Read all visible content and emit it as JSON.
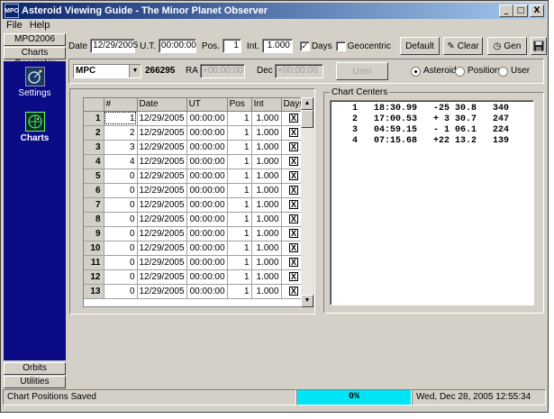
{
  "window": {
    "title": "Asteroid Viewing Guide - The Minor Planet Observer",
    "app_icon": "MPO",
    "controls": {
      "minimize": "_",
      "maximize": "□",
      "close": "X"
    }
  },
  "menu": {
    "file": "File",
    "help": "Help"
  },
  "nav": {
    "mpo_button": "MPO2006",
    "charts_generator": "Charts Generator",
    "settings_label": "Settings",
    "charts_label": "Charts",
    "orbits": "Orbits",
    "utilities": "Utilities"
  },
  "toolbar": {
    "date_label": "Date",
    "date_value": "12/29/2005",
    "ut_label": "U.T.",
    "ut_value": "00:00:00",
    "pos_label": "Pos.",
    "pos_value": "1",
    "int_label": "Int.",
    "int_value": "1.000",
    "days_label": "Days",
    "days_checked": true,
    "geocentric_label": "Geocentric",
    "geocentric_checked": false,
    "default_button": "Default",
    "clear_button": "Clear",
    "gen_button": "Gen"
  },
  "object_row": {
    "catalog_value": "MPC",
    "object_number": "266295",
    "ra_label": "RA",
    "ra_placeholder": "+00:00:00",
    "dec_label": "Dec",
    "dec_placeholder": "+00:00:00",
    "user_button": "User",
    "radio_asteroid": "Asteroid",
    "radio_position": "Position",
    "radio_user": "User",
    "selected": "Asteroid"
  },
  "grid": {
    "headers": [
      "#",
      "Date",
      "UT",
      "Pos",
      "Int",
      "Days"
    ],
    "rows": [
      {
        "row": "1",
        "num": "1",
        "date": "12/29/2005",
        "ut": "00:00:00",
        "pos": "1",
        "int": "1.000",
        "days": "X"
      },
      {
        "row": "2",
        "num": "2",
        "date": "12/29/2005",
        "ut": "00:00:00",
        "pos": "1",
        "int": "1.000",
        "days": "X"
      },
      {
        "row": "3",
        "num": "3",
        "date": "12/29/2005",
        "ut": "00:00:00",
        "pos": "1",
        "int": "1.000",
        "days": "X"
      },
      {
        "row": "4",
        "num": "4",
        "date": "12/29/2005",
        "ut": "00:00:00",
        "pos": "1",
        "int": "1.000",
        "days": "X"
      },
      {
        "row": "5",
        "num": "0",
        "date": "12/29/2005",
        "ut": "00:00:00",
        "pos": "1",
        "int": "1.000",
        "days": "X"
      },
      {
        "row": "6",
        "num": "0",
        "date": "12/29/2005",
        "ut": "00:00:00",
        "pos": "1",
        "int": "1.000",
        "days": "X"
      },
      {
        "row": "7",
        "num": "0",
        "date": "12/29/2005",
        "ut": "00:00:00",
        "pos": "1",
        "int": "1.000",
        "days": "X"
      },
      {
        "row": "8",
        "num": "0",
        "date": "12/29/2005",
        "ut": "00:00:00",
        "pos": "1",
        "int": "1.000",
        "days": "X"
      },
      {
        "row": "9",
        "num": "0",
        "date": "12/29/2005",
        "ut": "00:00:00",
        "pos": "1",
        "int": "1.000",
        "days": "X"
      },
      {
        "row": "10",
        "num": "0",
        "date": "12/29/2005",
        "ut": "00:00:00",
        "pos": "1",
        "int": "1.000",
        "days": "X"
      },
      {
        "row": "11",
        "num": "0",
        "date": "12/29/2005",
        "ut": "00:00:00",
        "pos": "1",
        "int": "1.000",
        "days": "X"
      },
      {
        "row": "12",
        "num": "0",
        "date": "12/29/2005",
        "ut": "00:00:00",
        "pos": "1",
        "int": "1.000",
        "days": "X"
      },
      {
        "row": "13",
        "num": "0",
        "date": "12/29/2005",
        "ut": "00:00:00",
        "pos": "1",
        "int": "1.000",
        "days": "X"
      }
    ]
  },
  "chart_centers": {
    "legend": "Chart Centers",
    "lines": [
      "    1   18:30.99   -25 30.8   340",
      "    2   17:00.53   + 3 30.7   247",
      "    3   04:59.15   - 1 06.1   224",
      "    4   07:15.68   +22 13.2   139"
    ]
  },
  "status": {
    "message": "Chart Positions Saved",
    "progress_text": "0%",
    "progress_color": "#00e5f5",
    "datetime": "Wed, Dec 28, 2005   12:55:34"
  }
}
